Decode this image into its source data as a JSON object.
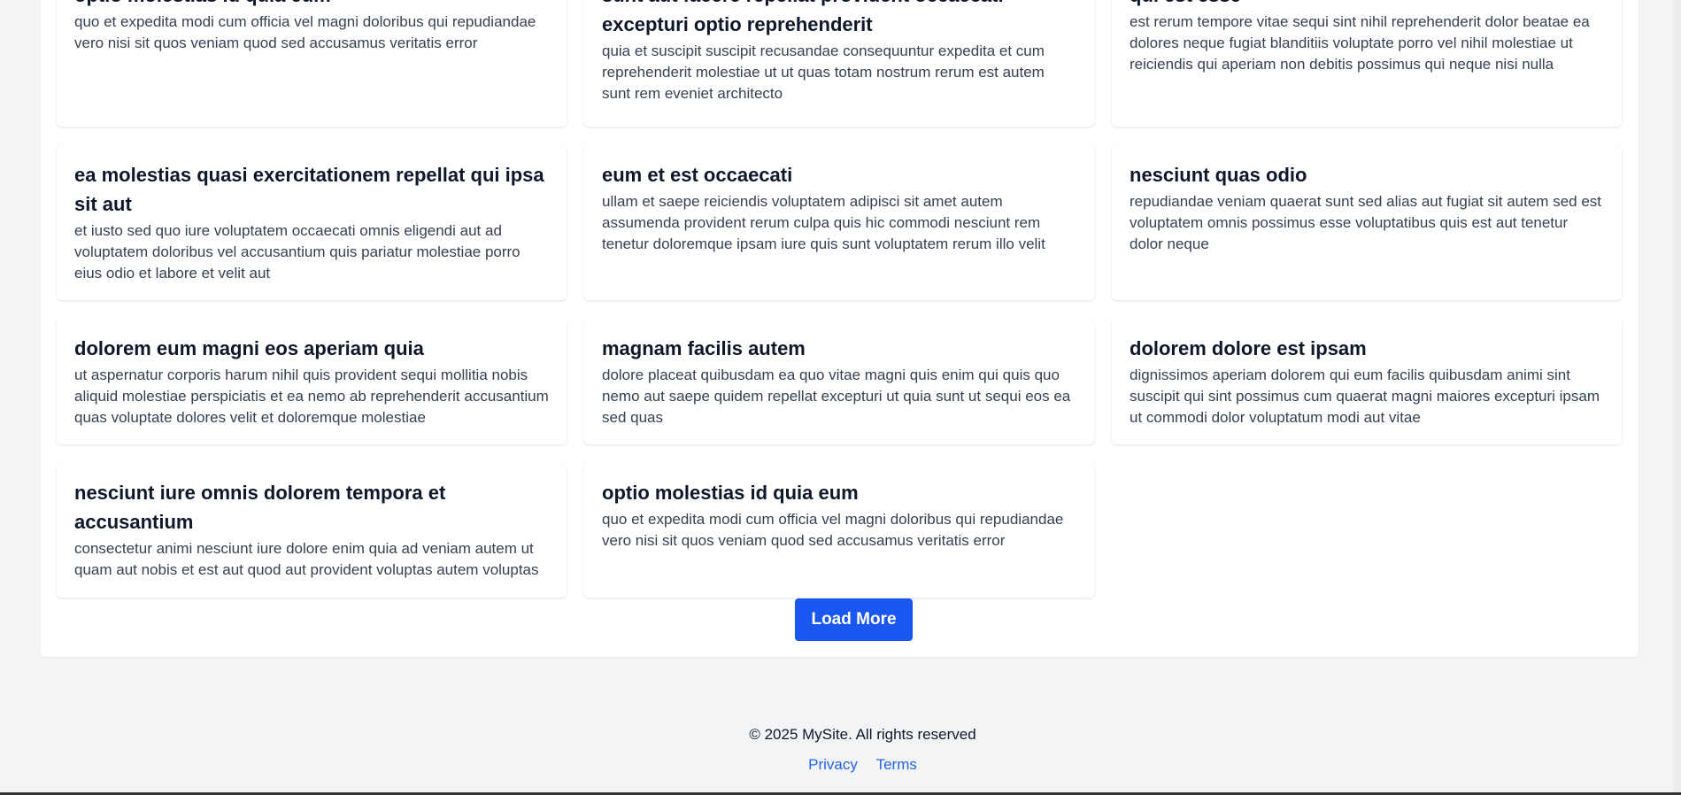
{
  "posts": [
    {
      "title": "optio molestias id quia eum",
      "body": "quo et expedita modi cum officia vel magni doloribus qui repudiandae vero nisi sit quos veniam quod sed accusamus veritatis error"
    },
    {
      "title": "sunt aut facere repellat provident occaecati excepturi optio reprehenderit",
      "body": "quia et suscipit suscipit recusandae consequuntur expedita et cum reprehenderit molestiae ut ut quas totam nostrum rerum est autem sunt rem eveniet architecto"
    },
    {
      "title": "qui est esse",
      "body": "est rerum tempore vitae sequi sint nihil reprehenderit dolor beatae ea dolores neque fugiat blanditiis voluptate porro vel nihil molestiae ut reiciendis qui aperiam non debitis possimus qui neque nisi nulla"
    },
    {
      "title": "ea molestias quasi exercitationem repellat qui ipsa sit aut",
      "body": "et iusto sed quo iure voluptatem occaecati omnis eligendi aut ad voluptatem doloribus vel accusantium quis pariatur molestiae porro eius odio et labore et velit aut"
    },
    {
      "title": "eum et est occaecati",
      "body": "ullam et saepe reiciendis voluptatem adipisci sit amet autem assumenda provident rerum culpa quis hic commodi nesciunt rem tenetur doloremque ipsam iure quis sunt voluptatem rerum illo velit"
    },
    {
      "title": "nesciunt quas odio",
      "body": "repudiandae veniam quaerat sunt sed alias aut fugiat sit autem sed est voluptatem omnis possimus esse voluptatibus quis est aut tenetur dolor neque"
    },
    {
      "title": "dolorem eum magni eos aperiam quia",
      "body": "ut aspernatur corporis harum nihil quis provident sequi mollitia nobis aliquid molestiae perspiciatis et ea nemo ab reprehenderit accusantium quas voluptate dolores velit et doloremque molestiae"
    },
    {
      "title": "magnam facilis autem",
      "body": "dolore placeat quibusdam ea quo vitae magni quis enim qui quis quo nemo aut saepe quidem repellat excepturi ut quia sunt ut sequi eos ea sed quas"
    },
    {
      "title": "dolorem dolore est ipsam",
      "body": "dignissimos aperiam dolorem qui eum facilis quibusdam animi sint suscipit qui sint possimus cum quaerat magni maiores excepturi ipsam ut commodi dolor voluptatum modi aut vitae"
    },
    {
      "title": "nesciunt iure omnis dolorem tempora et accusantium",
      "body": "consectetur animi nesciunt iure dolore enim quia ad veniam autem ut quam aut nobis et est aut quod aut provident voluptas autem voluptas"
    },
    {
      "title": "optio molestias id quia eum",
      "body": "quo et expedita modi cum officia vel magni doloribus qui repudiandae vero nisi sit quos veniam quod sed accusamus veritatis error"
    }
  ],
  "load_more_label": "Load More",
  "footer": {
    "copyright": "© 2025 MySite. All rights reserved",
    "links": [
      "Privacy",
      "Terms"
    ]
  },
  "colors": {
    "accent": "#1a56f0",
    "link": "#2563eb",
    "page_bg": "#f3f4f6"
  }
}
